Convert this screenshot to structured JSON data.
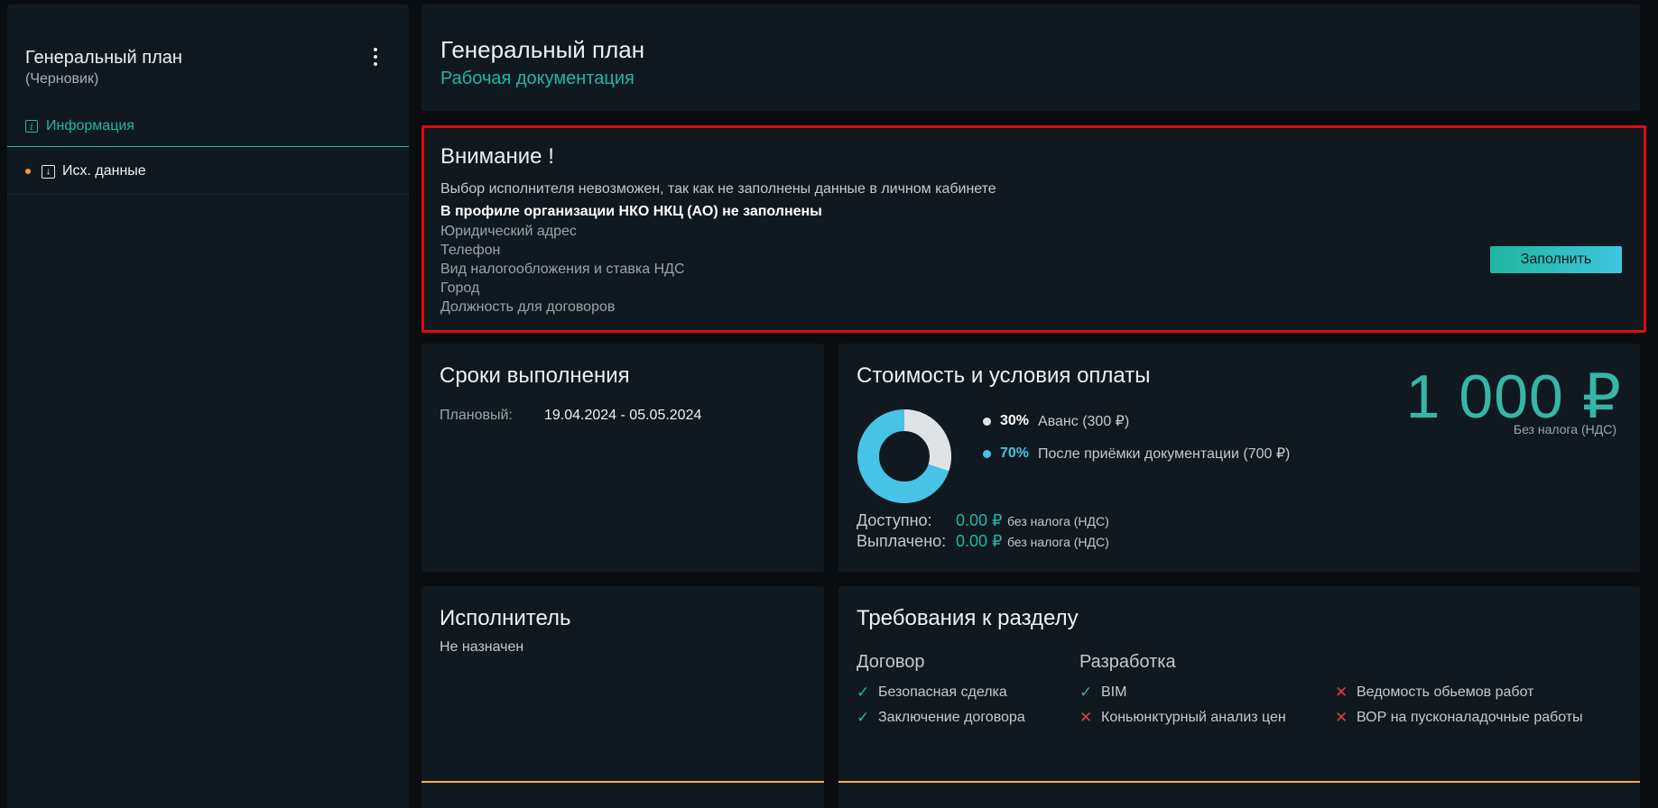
{
  "sidebar": {
    "title": "Генеральный план",
    "subtitle": "(Черновик)",
    "tab": "Информация",
    "item": "Исх. данные"
  },
  "header": {
    "title": "Генеральный план",
    "subtitle": "Рабочая документация"
  },
  "warning": {
    "title": "Внимание !",
    "message": "Выбор исполнителя невозможен, так как не заполнены данные в личном кабинете",
    "profile_line": "В профиле организации НКО НКЦ (АО) не заполнены",
    "missing": [
      "Юридический адрес",
      "Телефон",
      "Вид налогообложения и ставка НДС",
      "Город",
      "Должность для договоров"
    ],
    "button": "Заполнить"
  },
  "terms": {
    "title": "Сроки выполнения",
    "label": "Плановый:",
    "value": "19.04.2024 - 05.05.2024"
  },
  "cost": {
    "title": "Стоимость и условия оплаты",
    "price": "1 000 ₽",
    "price_note": "Без налога (НДС)",
    "legend": [
      {
        "pct": "30%",
        "text": "Аванс (300 ₽)",
        "color": "#dfe3e6",
        "value": 30
      },
      {
        "pct": "70%",
        "text": "После приёмки документации (700 ₽)",
        "color": "#46c3e6",
        "value": 70
      }
    ],
    "available_label": "Доступно:",
    "available_value": "0.00 ₽",
    "available_note": "без налога (НДС)",
    "paid_label": "Выплачено:",
    "paid_value": "0.00 ₽",
    "paid_note": "без налога (НДС)"
  },
  "executor": {
    "title": "Исполнитель",
    "value": "Не назначен"
  },
  "requirements": {
    "title": "Требования к разделу",
    "contract_head": "Договор",
    "dev_head": "Разработка",
    "contract_items": [
      {
        "label": "Безопасная сделка",
        "ok": true
      },
      {
        "label": "Заключение договора",
        "ok": true
      }
    ],
    "dev_items": [
      {
        "label": "BIM",
        "ok": true
      },
      {
        "label": "Коньюнктурный анализ цен",
        "ok": false
      }
    ],
    "extra_items": [
      {
        "label": "Ведомость обьемов работ",
        "ok": false
      },
      {
        "label": "ВОР на пусконаладочные работы",
        "ok": false
      }
    ]
  },
  "colors": {
    "accent": "#1fb7a2",
    "alert_border": "#e10c0c",
    "orange": "#f2b14a"
  }
}
